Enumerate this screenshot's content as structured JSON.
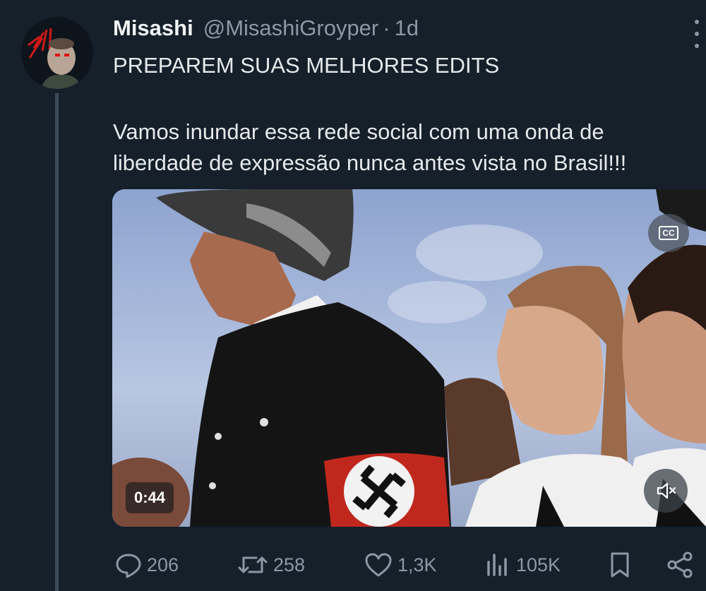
{
  "author": {
    "display_name": "Misashi",
    "handle": "@MisashiGroyper",
    "separator": "·",
    "time": "1d"
  },
  "tweet": {
    "lines": [
      "PREPAREM SUAS MELHORES EDITS",
      "Vamos inundar essa rede social com uma onda de",
      "liberdade de expressão nunca antes vista no Brasil!!!"
    ]
  },
  "media": {
    "type": "video",
    "duration": "0:44",
    "cc_label": "CC",
    "muted": true
  },
  "actions": {
    "replies": "206",
    "reposts": "258",
    "likes": "1,3K",
    "views": "105K"
  },
  "colors": {
    "background": "#15202b",
    "primary_text": "#e7e9ea",
    "secondary_text": "#8b98a5",
    "thread_line": "#3a4a5a"
  },
  "icons": [
    "more-icon",
    "cc-icon",
    "mute-icon",
    "reply-icon",
    "repost-icon",
    "like-icon",
    "views-icon",
    "bookmark-icon",
    "share-icon"
  ]
}
